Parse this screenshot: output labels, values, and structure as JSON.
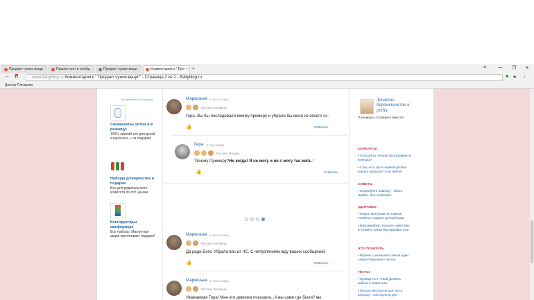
{
  "browser": {
    "tabs": [
      {
        "label": "Продает чужие вещи"
      },
      {
        "label": "Пишем пост в сообщ"
      },
      {
        "label": "Продает чужие вещи"
      },
      {
        "label": "Комментарии к \" Про"
      }
    ],
    "window_buttons": {
      "menu": "≡",
      "minimize": "—",
      "restore": "❐",
      "close": "✕"
    },
    "new_tab": "+",
    "back": "←",
    "yandex": "Я",
    "address_domain": "www.babyblog.ru",
    "address_title": "Комментарии к \" Продает чужие вещи!\" - Страница 2 из 2 - Babyblog.ru",
    "bookmark": "Доктор Плюшева"
  },
  "left_column": {
    "ad_label": "Объявления на Babyblog",
    "ads": [
      {
        "title": "Снежколепы оптом и в розницу!",
        "desc": "100% зимний хит для детей и взрослых + на подарки!"
      },
      {
        "title": "Наборы д/творчества и подарки",
        "desc": "Все для родительского комитета по опт. ценам"
      },
      {
        "title": "Конструкторы магформерс",
        "desc": "Все наборы. Магнитная акция притягивает подарки!"
      }
    ]
  },
  "comments": [
    {
      "author": "Маркизька",
      "when": "2 часа назад",
      "location": "Россия, Коломна",
      "text": "Гера. Вы бы последовали моему примеру и убрали бы меня из своего чс.",
      "reply": "Ответить"
    },
    {
      "author": "Гера",
      "when": "1 час назад",
      "location": "Россия, Москва",
      "text_prefix": "Твоему Примеру?",
      "text_bold": "Не когда! Я не могу и не с могу так жить",
      "text_suffix": " !",
      "reply": "Ответить"
    },
    {
      "author": "Маркизька",
      "when": "2 часа назад",
      "location": "Россия, Коломна",
      "text": "Да ради Бога. Убрала вас из ЧС. С нетерпением жду ваших сообщений.",
      "reply": "Ответить"
    },
    {
      "author": "Маркизька",
      "when": "2 часа назад",
      "location": "Россия, Коломна",
      "text": "Уважаемая Гера! Мне его девочка показала...А вы сами где были? вы"
    }
  ],
  "more_glyph": "…",
  "like_glyph": "👍",
  "pagination": {
    "total": 4,
    "active": 4
  },
  "right_column": {
    "promo_title": "Зачатие, беременность и роды",
    "promo_sub": "Планирую, готовимся вместе!",
    "sections": [
      {
        "heading": "КОНКУРСЫ",
        "links": [
          "• Голосуй за лучшую фотографию в конкурсе!",
          "• У вас есть фото первой улыбки вашего малыша? Участвуйте!"
        ]
      },
      {
        "heading": "СОВЕТЫ",
        "links": [
          "• Попробуйте новинку – Libero Up&Go, Zoo Collection!"
        ]
      },
      {
        "heading": "ЗДОРОВЬЕ",
        "links": [
          "• Нороз прогулкам не помеха! Узнайте о защите детской кожи",
          "• Максимайзер: Укажите симптомы и узнайте, какой бактериофаг пом"
        ]
      },
      {
        "heading": "ЧТО ПОЧИТАТЬ",
        "links": [
          "• Играем с малышом: Новые идеи «Игра+Обучение» Читать"
        ]
      },
      {
        "heading": "ТЕСТЫ",
        "links": [
          "• Пройди тест «Твой уровень заботы о животных»",
          "• Получи бесплатно для теста игрушку – конструктор для"
        ]
      }
    ]
  },
  "colors": {
    "page_bg": "#f3d9d9",
    "link": "#1f5fa8",
    "heading_red": "#c4314b"
  }
}
